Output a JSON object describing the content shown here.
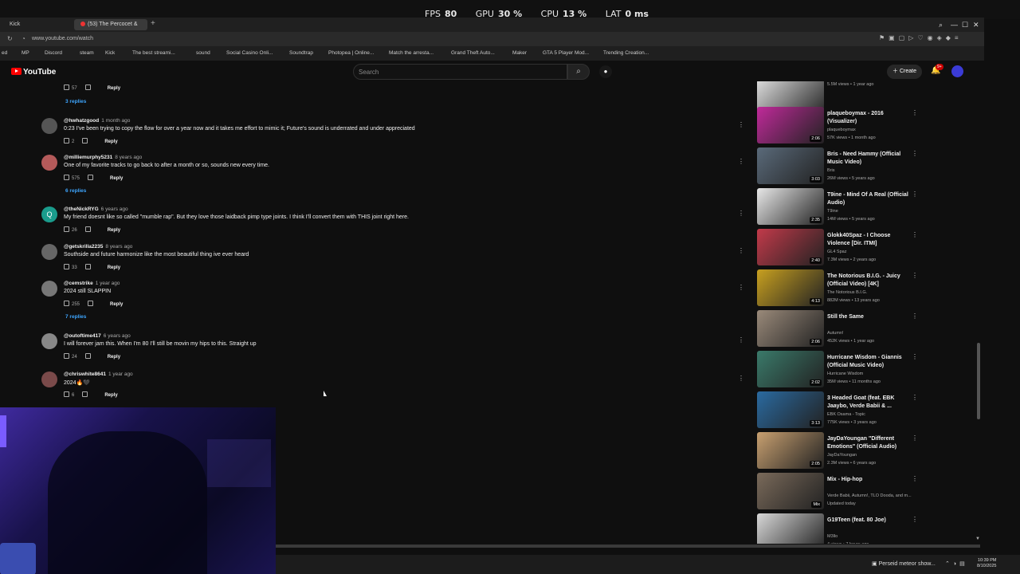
{
  "perf": {
    "fps_label": "FPS",
    "fps": "80",
    "gpu_label": "GPU",
    "gpu": "30 %",
    "cpu_label": "CPU",
    "cpu": "13 %",
    "lat_label": "LAT",
    "lat": "0 ms"
  },
  "tabs": {
    "kick": "Kick",
    "active": "(53) The Percocet &",
    "new": "+"
  },
  "address": {
    "url": "www.youtube.com/watch"
  },
  "bookmarks": [
    "ed",
    "MP",
    "Discord",
    "steam",
    "Kick",
    "The best streami...",
    "sound",
    "Social Casino Onli...",
    "Soundtrap",
    "Photopea | Online...",
    "Match the arresta...",
    "Grand Theft Auto...",
    "Maker",
    "GTA 5 Player Mod...",
    "Trending Creation..."
  ],
  "header": {
    "logo": "YouTube",
    "search_placeholder": "Search",
    "create": "Create",
    "notif_badge": "9+"
  },
  "comments": [
    {
      "type": "actions",
      "likes": "57",
      "reply": "Reply"
    },
    {
      "type": "replies",
      "label": "3 replies"
    },
    {
      "handle": "@hwhatzgood",
      "time": "1 month ago",
      "text": "0:23 I've been trying to copy the flow for over a year now and it takes me effort to mimic it; Future's sound is underrated and under appreciated",
      "likes": "2",
      "reply": "Reply",
      "avatar": "#555"
    },
    {
      "handle": "@milliemurphy5231",
      "time": "8 years ago",
      "text": "One of my favorite tracks to go back to after a month or so, sounds new every time.",
      "likes": "575",
      "reply": "Reply",
      "avatar": "#b45a5a",
      "replies": "6 replies"
    },
    {
      "handle": "@theNickRYG",
      "time": "6 years ago",
      "text": "My friend doesnt like so called \"mumble rap\". But they love those laidback pimp type joints. I think I'll convert them with THIS joint right here.",
      "likes": "26",
      "reply": "Reply",
      "avatar": "#1a9c8c",
      "initial": "Q"
    },
    {
      "handle": "@getskrilla2235",
      "time": "8 years ago",
      "text": "Southside and future harmonize like the most beautiful thing ive ever heard",
      "likes": "33",
      "reply": "Reply",
      "avatar": "#666"
    },
    {
      "handle": "@cemstrike",
      "time": "1 year ago",
      "text": "2024 still SLAPPIN",
      "likes": "255",
      "reply": "Reply",
      "avatar": "#777",
      "replies": "7 replies"
    },
    {
      "handle": "@outoftime417",
      "time": "6 years ago",
      "text": "I will forever jam this. When I'm 80 I'll still be movin my hips to this.  Straight up",
      "likes": "24",
      "reply": "Reply",
      "avatar": "#888"
    },
    {
      "handle": "@chriswhite8641",
      "time": "1 year ago",
      "text": "2024🔥🖤",
      "likes": "6",
      "reply": "Reply",
      "avatar": "#7a4a4a"
    }
  ],
  "related": [
    {
      "title": "",
      "channel": "",
      "stats": "5.5M views • 1 year ago",
      "duration": "",
      "color": "#ddd"
    },
    {
      "title": "plaqueboymax - 2016 (Visualizer)",
      "channel": "plaqueboymax",
      "stats": "57K views • 1 month ago",
      "duration": "2:06",
      "color": "#c02a9a"
    },
    {
      "title": "Bris - Need Hammy (Official Music Video)",
      "channel": "Bris",
      "stats": "26M views • 5 years ago",
      "duration": "3:03",
      "color": "#5a6a7a"
    },
    {
      "title": "T9ine - Mind Of A Real (Official Audio)",
      "channel": "T9ine",
      "stats": "14M views • 5 years ago",
      "duration": "2:35",
      "color": "#e8e8e8"
    },
    {
      "title": "Glokk40Spaz - I Choose Violence [Dir. ITMI]",
      "channel": "GL4 Spaz",
      "stats": "7.3M views • 2 years ago",
      "duration": "2:40",
      "color": "#c23a4a"
    },
    {
      "title": "The Notorious B.I.G. - Juicy (Official Video) [4K]",
      "channel": "The Notorious B.I.G.",
      "stats": "882M views • 13 years ago",
      "duration": "4:13",
      "color": "#c8a020"
    },
    {
      "title": "Still the Same",
      "channel": "Autumn!",
      "stats": "452K views • 1 year ago",
      "duration": "2:06",
      "color": "#9a8a7a"
    },
    {
      "title": "Hurricane Wisdom - Giannis (Official Music Video)",
      "channel": "Hurricane Wisdom",
      "stats": "35M views • 11 months ago",
      "duration": "2:02",
      "color": "#3a7a6a"
    },
    {
      "title": "3 Headed Goat (feat. EBK Jaaybo, Verde Babii & ...",
      "channel": "EBK Osama - Topic",
      "stats": "775K views • 3 years ago",
      "duration": "3:13",
      "color": "#2a6aa0"
    },
    {
      "title": "JayDaYoungan \"Different Emotions\" (Official Audio)",
      "channel": "JayDaYoungan",
      "stats": "2.3M views • 6 years ago",
      "duration": "2:05",
      "color": "#c8a070"
    },
    {
      "title": "Mix - Hip-hop",
      "channel": "Verde Babii, Autumn!, TLO Dooda, and m...",
      "stats": "Updated today",
      "duration": "Mix",
      "color": "#7a6a5a"
    },
    {
      "title": "G19Teen (feat. 80 Joe)",
      "channel": "M3llo",
      "stats": "4 views • 7 hours ago",
      "duration": "",
      "color": "#d8d8d8"
    }
  ],
  "taskbar": {
    "media": "Perseid meteor show...",
    "time": "10:39 PM",
    "date": "8/10/2025"
  },
  "icons": {
    "search": "search-icon",
    "mic": "mic-icon",
    "bell": "bell-icon",
    "create": "plus-icon"
  }
}
